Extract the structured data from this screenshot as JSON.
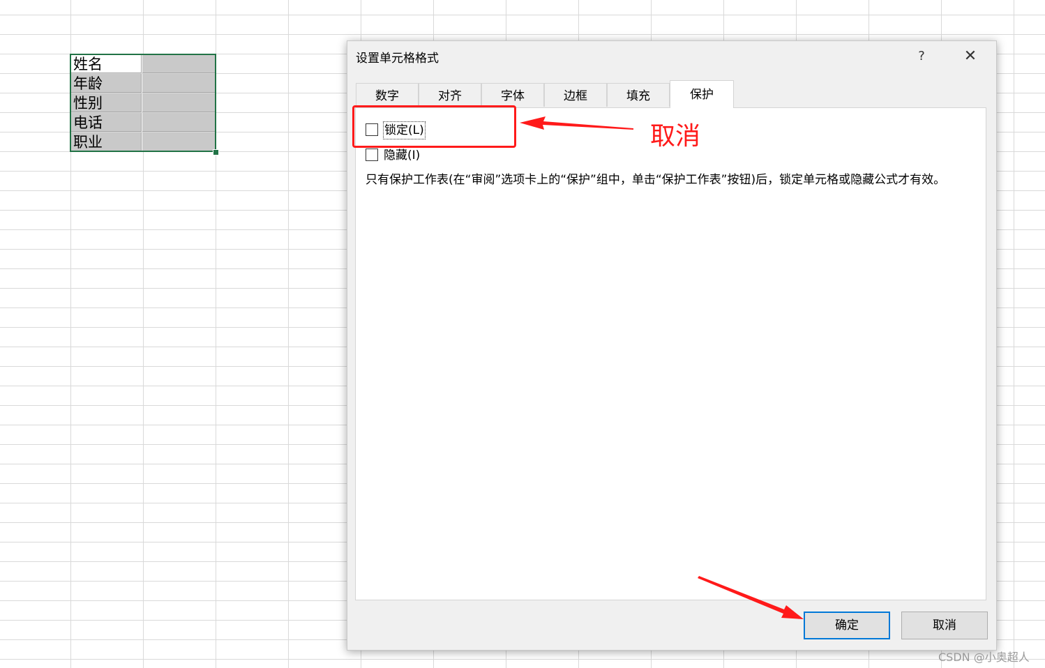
{
  "spreadsheet": {
    "cells": [
      "姓名",
      "年龄",
      "性别",
      "电话",
      "职业"
    ]
  },
  "dialog": {
    "title": "设置单元格格式",
    "help_label": "?",
    "close_label": "✕",
    "tabs": [
      {
        "label": "数字",
        "active": false
      },
      {
        "label": "对齐",
        "active": false
      },
      {
        "label": "字体",
        "active": false
      },
      {
        "label": "边框",
        "active": false
      },
      {
        "label": "填充",
        "active": false
      },
      {
        "label": "保护",
        "active": true
      }
    ],
    "protection": {
      "locked_label": "锁定(L)",
      "locked_checked": false,
      "hidden_label": "隐藏(I)",
      "hidden_checked": false,
      "info": "只有保护工作表(在“审阅”选项卡上的“保护”组中，单击“保护工作表”按钮)后，锁定单元格或隐藏公式才有效。"
    },
    "ok_label": "确定",
    "cancel_label": "取消"
  },
  "annotation": {
    "text": "取消",
    "color": "#ff1a1a"
  },
  "watermark": "CSDN @小奥超人"
}
